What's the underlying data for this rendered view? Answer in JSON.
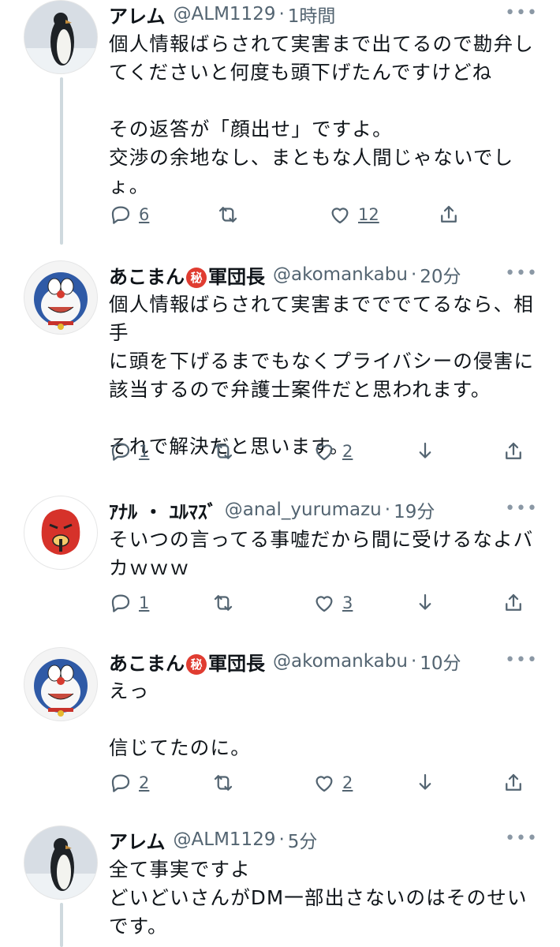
{
  "tweets": [
    {
      "name": "アレム",
      "handle": "@ALM1129",
      "time": "1時間",
      "lines": [
        "個人情報ばらされて実害まで出てるので勘弁し",
        "てくださいと何度も頭下げたんですけどね",
        "",
        "その返答が「顔出せ」ですよ。",
        "交渉の余地なし、まともな人間じゃないでし",
        "ょ。"
      ],
      "replies": "6",
      "retweets": "",
      "likes": "12",
      "avatar": "penguin",
      "badge": ""
    },
    {
      "name": "あこまん",
      "name_suffix": "軍団長",
      "badge": "秘",
      "handle": "@akomankabu",
      "time": "20分",
      "lines": [
        "個人情報ばらされて実害までででてるなら、相手",
        "に頭を下げるまでもなくプライバシーの侵害に",
        "該当するので弁護士案件だと思われます。",
        "",
        "それで解決だと思います。"
      ],
      "replies": "1",
      "retweets": "",
      "likes": "2",
      "avatar": "doraemon"
    },
    {
      "name": "ｱﾅﾙ ・ ﾕﾙﾏｽﾞ",
      "handle": "@anal_yurumazu",
      "time": "19分",
      "lines": [
        "そいつの言ってる事嘘だから間に受けるなよバ",
        "カｗｗｗ"
      ],
      "replies": "1",
      "retweets": "",
      "likes": "3",
      "avatar": "red-mask",
      "badge": ""
    },
    {
      "name": "あこまん",
      "name_suffix": "軍団長",
      "badge": "秘",
      "handle": "@akomankabu",
      "time": "10分",
      "lines": [
        "えっ",
        "",
        "信じてたのに。"
      ],
      "replies": "2",
      "retweets": "",
      "likes": "2",
      "avatar": "doraemon"
    },
    {
      "name": "アレム",
      "handle": "@ALM1129",
      "time": "5分",
      "lines": [
        "全て事実ですよ",
        "どいどいさんがDM一部出さないのはそのせい",
        "です。"
      ],
      "avatar": "penguin",
      "badge": ""
    }
  ],
  "ui": {
    "more": "•••",
    "dot": "·"
  },
  "colors": {
    "text": "#0f1419",
    "secondary": "#536471",
    "thread": "#cfd9de",
    "badge": "#e03c31"
  }
}
